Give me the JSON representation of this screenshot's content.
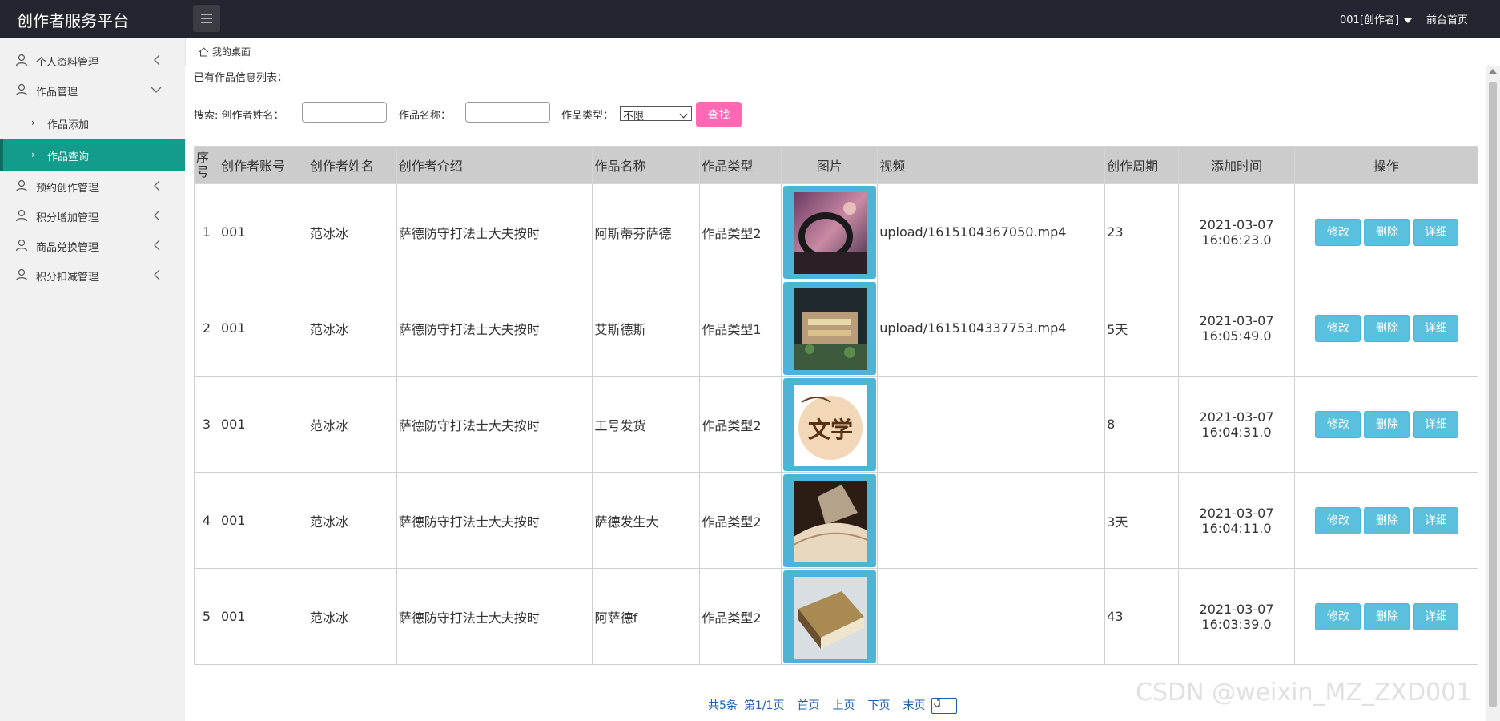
{
  "header": {
    "app_title": "创作者服务平台",
    "user_label": "001[创作者]",
    "front_link": "前台首页"
  },
  "sidebar": {
    "items": [
      {
        "label": "个人资料管理",
        "icon": "user-icon",
        "expanded": false
      },
      {
        "label": "作品管理",
        "icon": "user-icon",
        "expanded": true
      },
      {
        "label": "预约创作管理",
        "icon": "user-icon",
        "expanded": false
      },
      {
        "label": "积分增加管理",
        "icon": "user-icon",
        "expanded": false
      },
      {
        "label": "商品兑换管理",
        "icon": "user-icon",
        "expanded": false
      },
      {
        "label": "积分扣减管理",
        "icon": "user-icon",
        "expanded": false
      }
    ],
    "subitems": [
      {
        "label": "作品添加",
        "active": false
      },
      {
        "label": "作品查询",
        "active": true
      }
    ],
    "active_color": "#119c8b"
  },
  "breadcrumb": {
    "label": "我的桌面"
  },
  "page": {
    "caption": "已有作品信息列表："
  },
  "search": {
    "prefix": "搜索: 创作者姓名：",
    "name_value": "",
    "work_label": "作品名称：",
    "work_value": "",
    "type_label": "作品类型：",
    "type_selected": "不限",
    "button_label": "查找",
    "button_color": "#ff69b4"
  },
  "table": {
    "headers": [
      "序号",
      "创作者账号",
      "创作者姓名",
      "创作者介绍",
      "作品名称",
      "作品类型",
      "图片",
      "视频",
      "创作周期",
      "添加时间",
      "操作"
    ],
    "rows": [
      {
        "no": "1",
        "account": "001",
        "name": "范冰冰",
        "intro": "萨德防守打法士大夫按时",
        "title": "阿斯蒂芬萨德",
        "type": "作品类型2",
        "image": "car-photo",
        "video": "upload/1615104367050.mp4",
        "cycle": "23",
        "date": "2021-03-07",
        "time": "16:06:23.0"
      },
      {
        "no": "2",
        "account": "001",
        "name": "范冰冰",
        "intro": "萨德防守打法士大夫按时",
        "title": "艾斯德斯",
        "type": "作品类型1",
        "image": "building-model-photo",
        "video": "upload/1615104337753.mp4",
        "cycle": "5天",
        "date": "2021-03-07",
        "time": "16:05:49.0"
      },
      {
        "no": "3",
        "account": "001",
        "name": "范冰冰",
        "intro": "萨德防守打法士大夫按时",
        "title": "工号发货",
        "type": "作品类型2",
        "image": "literature-logo",
        "video": "",
        "cycle": "8",
        "date": "2021-03-07",
        "time": "16:04:31.0"
      },
      {
        "no": "4",
        "account": "001",
        "name": "范冰冰",
        "intro": "萨德防守打法士大夫按时",
        "title": "萨德发生大",
        "type": "作品类型2",
        "image": "open-book-photo",
        "video": "",
        "cycle": "3天",
        "date": "2021-03-07",
        "time": "16:04:11.0"
      },
      {
        "no": "5",
        "account": "001",
        "name": "范冰冰",
        "intro": "萨德防守打法士大夫按时",
        "title": "阿萨德f",
        "type": "作品类型2",
        "image": "old-book-photo",
        "video": "",
        "cycle": "43",
        "date": "2021-03-07",
        "time": "16:03:39.0"
      }
    ],
    "actions": {
      "edit": "修改",
      "delete": "删除",
      "detail": "详细"
    },
    "logo_text": "文学",
    "button_color": "#5bc0de"
  },
  "pager": {
    "summary": "共5条",
    "page_info": "第1/1页",
    "first": "首页",
    "prev": "上页",
    "next": "下页",
    "last": "末页",
    "page_select": "1"
  },
  "watermark": "CSDN @weixin_MZ_ZXD001"
}
